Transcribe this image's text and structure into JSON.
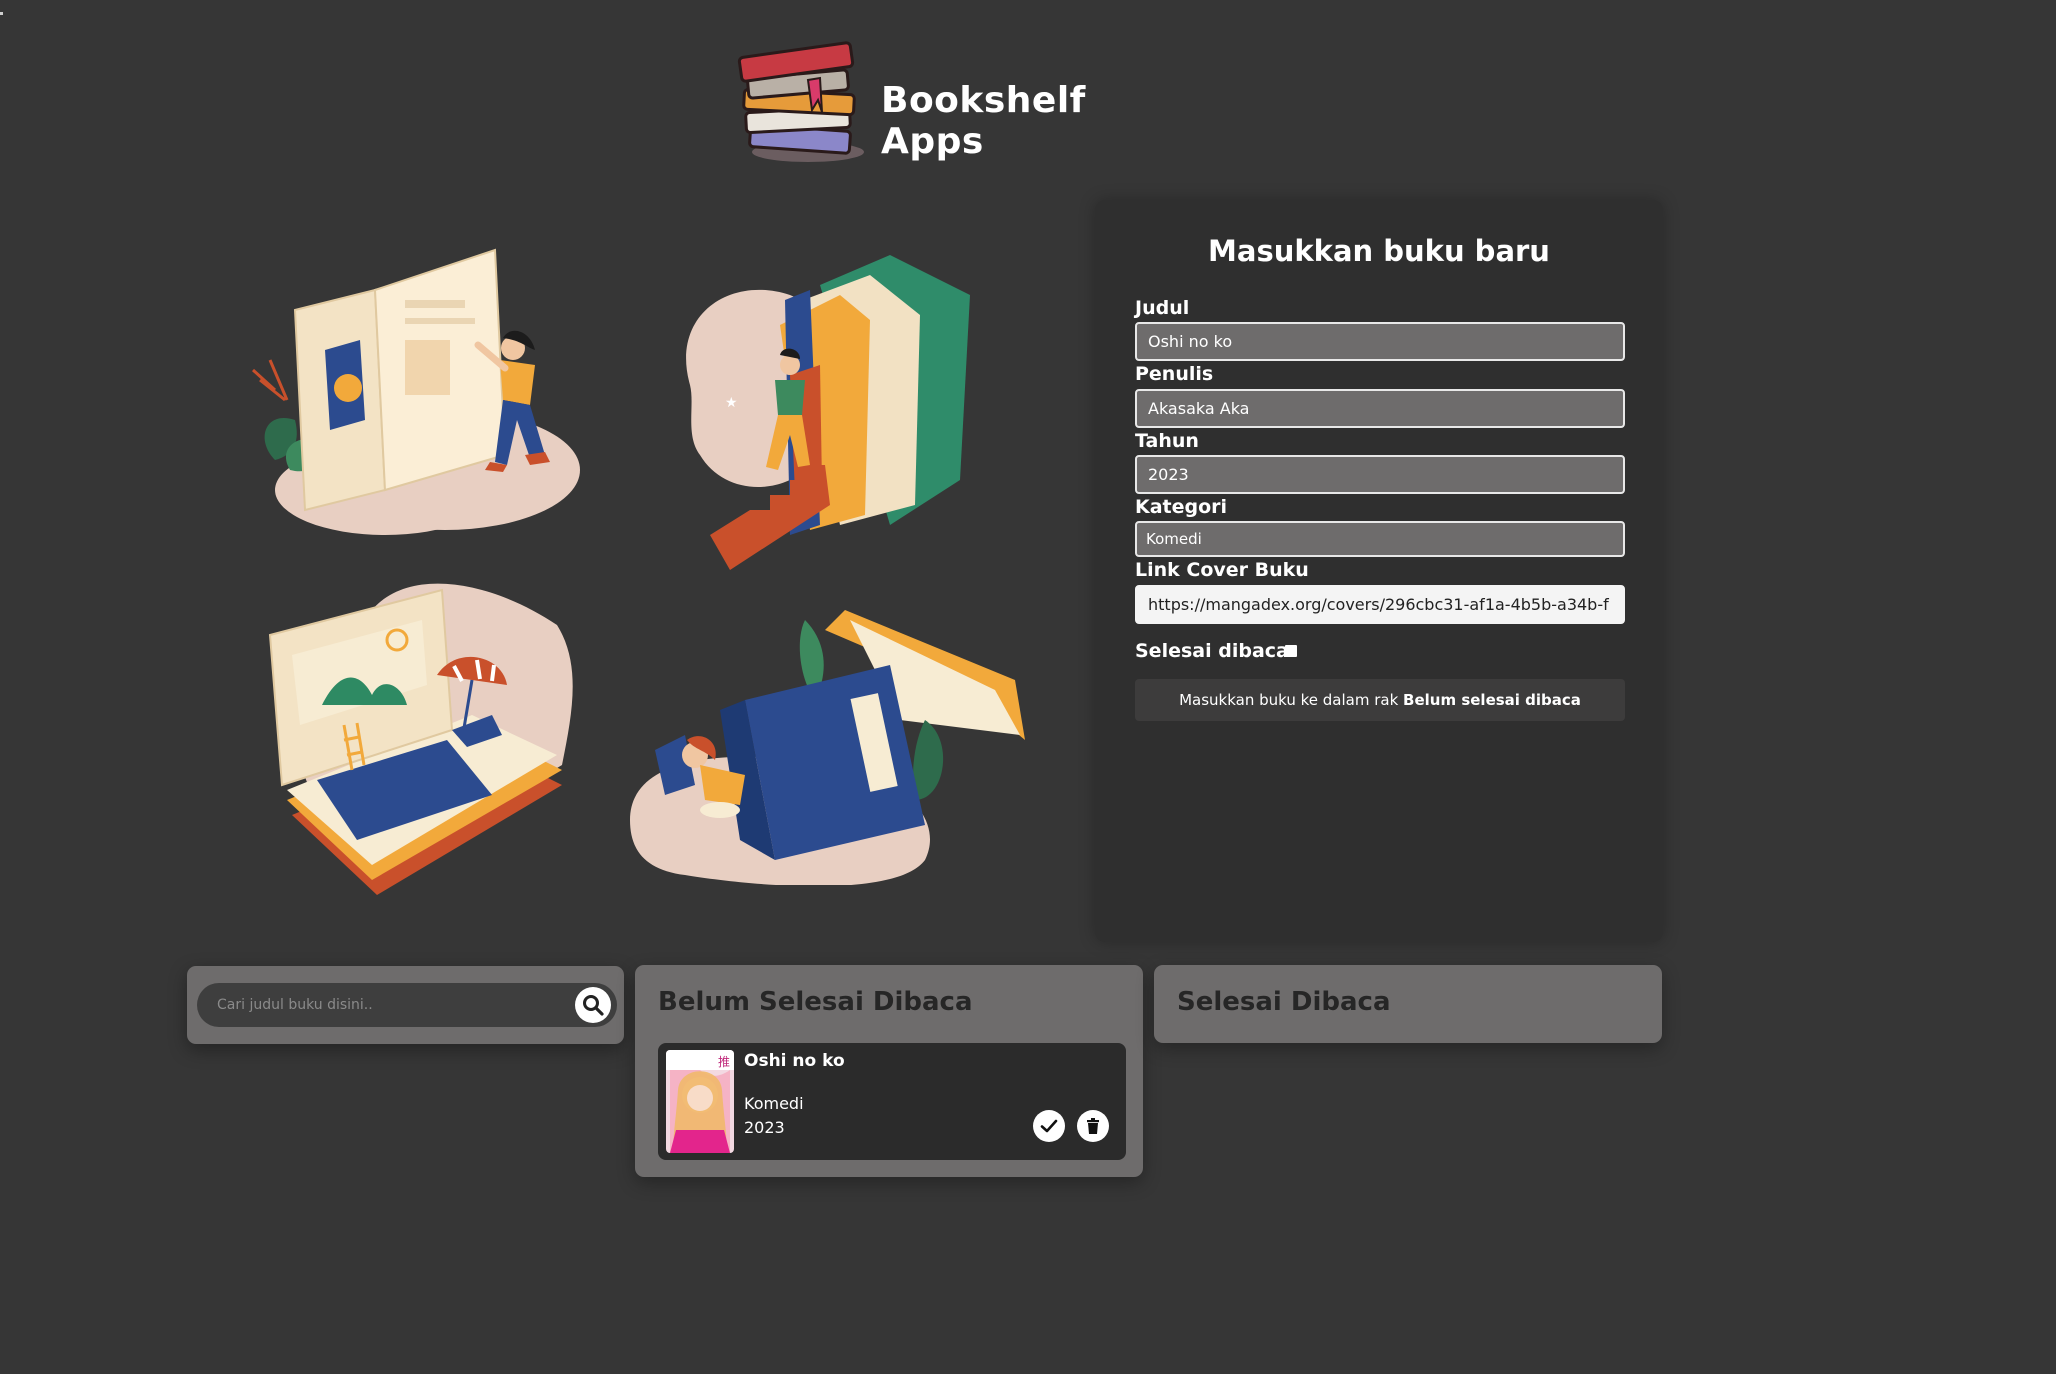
{
  "header": {
    "title": "Bookshelf Apps"
  },
  "form": {
    "title": "Masukkan buku baru",
    "fields": {
      "judul": {
        "label": "Judul",
        "value": "Oshi no ko"
      },
      "penulis": {
        "label": "Penulis",
        "value": "Akasaka Aka"
      },
      "tahun": {
        "label": "Tahun",
        "value": "2023"
      },
      "kategori": {
        "label": "Kategori",
        "value": "Komedi"
      },
      "cover": {
        "label": "Link Cover Buku",
        "value": "https://mangadex.org/covers/296cbc31-af1a-4b5b-a34b-f"
      }
    },
    "checkbox_label": "Selesai dibaca",
    "submit_prefix": "Masukkan buku ke dalam rak",
    "submit_bold": "Belum selesai dibaca"
  },
  "search": {
    "placeholder": "Cari judul buku disini..",
    "button_icon": "search-icon"
  },
  "shelves": {
    "unread": {
      "title": "Belum Selesai Dibaca",
      "books": [
        {
          "title": "Oshi no ko",
          "category": "Komedi",
          "year": "2023"
        }
      ]
    },
    "read": {
      "title": "Selesai Dibaca"
    }
  },
  "colors": {
    "background": "#363636",
    "panel": "#2f2f2f",
    "shelf": "#6e6c6c",
    "input": "#6e6c6c"
  }
}
